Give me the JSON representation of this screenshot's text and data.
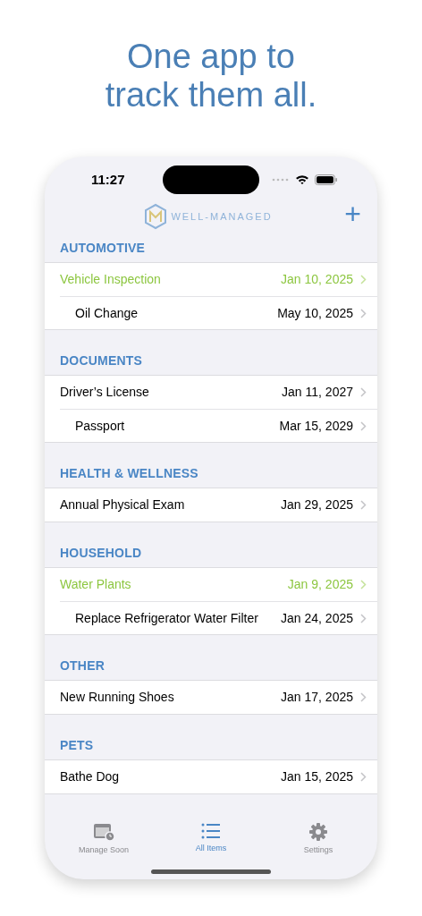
{
  "headline": [
    "One app to",
    "track them all."
  ],
  "status_bar": {
    "time": "11:27"
  },
  "header": {
    "logo_text": "WELL-MANAGED",
    "add_button": "+"
  },
  "sections": [
    {
      "title": "AUTOMOTIVE",
      "items": [
        {
          "name": "Vehicle Inspection",
          "date": "Jan 10, 2025",
          "highlighted": true
        },
        {
          "name": "Oil Change",
          "date": "May 10, 2025",
          "highlighted": false
        }
      ]
    },
    {
      "title": "DOCUMENTS",
      "items": [
        {
          "name": "Driver’s License",
          "date": "Jan 11, 2027",
          "highlighted": false
        },
        {
          "name": "Passport",
          "date": "Mar 15, 2029",
          "highlighted": false
        }
      ]
    },
    {
      "title": "HEALTH & WELLNESS",
      "items": [
        {
          "name": "Annual Physical Exam",
          "date": "Jan 29, 2025",
          "highlighted": false
        }
      ]
    },
    {
      "title": "HOUSEHOLD",
      "items": [
        {
          "name": "Water Plants",
          "date": "Jan 9, 2025",
          "highlighted": true
        },
        {
          "name": "Replace Refrigerator Water Filter",
          "date": "Jan 24, 2025",
          "highlighted": false
        }
      ]
    },
    {
      "title": "OTHER",
      "items": [
        {
          "name": "New Running Shoes",
          "date": "Jan 17, 2025",
          "highlighted": false
        }
      ]
    },
    {
      "title": "PETS",
      "items": [
        {
          "name": "Bathe Dog",
          "date": "Jan 15, 2025",
          "highlighted": false
        }
      ]
    }
  ],
  "tabs": [
    {
      "label": "Manage Soon",
      "kind": "calendar",
      "selected": false
    },
    {
      "label": "All Items",
      "kind": "list",
      "selected": true
    },
    {
      "label": "Settings",
      "kind": "gear",
      "selected": false
    }
  ]
}
